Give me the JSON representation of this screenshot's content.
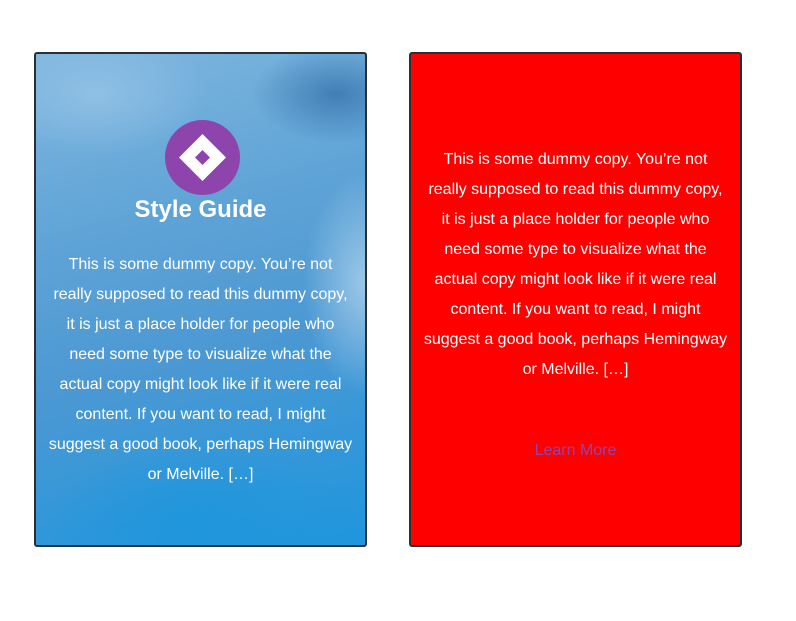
{
  "cards": [
    {
      "icon": "diamond-icon",
      "icon_color": "#8e44ad",
      "title": "Style Guide",
      "text": "This is some dummy copy. You’re not really supposed to read this dummy copy, it is just a place holder for people who need some type to visualize what the actual copy might look like if it were real content. If you want to read, I might suggest a good book, perhaps Hemingway or Melville. […]"
    },
    {
      "background_color": "#ff0000",
      "text": "This is some dummy copy. You’re not really supposed to read this dummy copy, it is just a place holder for people who need some type to visualize what the actual copy might look like if it were real content. If you want to read, I might suggest a good book, perhaps Hemingway or Melville. […]",
      "link_label": "Learn More",
      "link_color": "#8e44ad"
    }
  ]
}
